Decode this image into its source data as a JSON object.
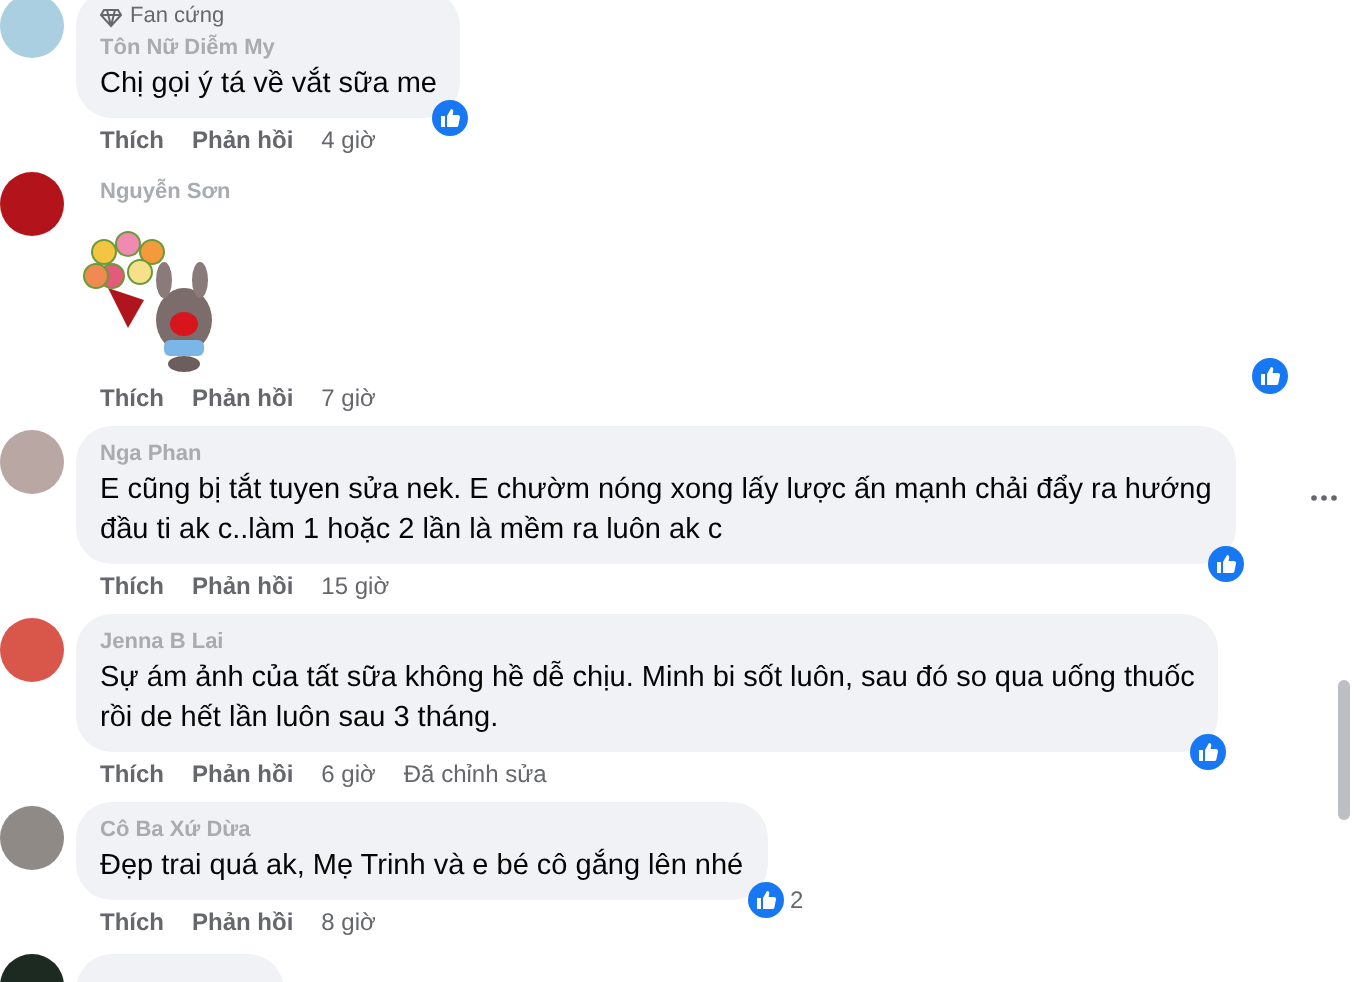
{
  "comments": [
    {
      "kind": "text",
      "badge": "Fan cứng",
      "name": "Tôn Nữ Diễm My",
      "text": "Chị gọi ý tá về vắt sữa me",
      "reacted": true,
      "actions": {
        "like": "Thích",
        "reply": "Phản hồi",
        "time": "4 giờ"
      },
      "more": false
    },
    {
      "kind": "sticker",
      "name": "Nguyễn Sơn",
      "reacted": true,
      "actions": {
        "like": "Thích",
        "reply": "Phản hồi",
        "time": "7 giờ"
      },
      "more": false
    },
    {
      "kind": "text",
      "name": "Nga Phan",
      "text": "E cũng bị tắt tuyen sửa nek. E chườm nóng xong lấy lược ấn mạnh chải đẩy ra hướng\nđầu ti ak c..làm 1 hoặc 2 lần là mềm ra luôn ak c",
      "reacted": true,
      "actions": {
        "like": "Thích",
        "reply": "Phản hồi",
        "time": "15 giờ"
      },
      "more": true
    },
    {
      "kind": "text",
      "name": "Jenna B Lai",
      "text": "Sự ám ảnh của tất sữa không hề dễ chịu. Minh bi sốt luôn, sau đó so qua uống thuốc\nrồi de hết lần luôn sau 3 tháng.",
      "reacted": true,
      "actions": {
        "like": "Thích",
        "reply": "Phản hồi",
        "time": "6 giờ",
        "edited": "Đã chỉnh sửa"
      },
      "more": false
    },
    {
      "kind": "text",
      "name": "Cô Ba Xứ Dừa",
      "text": "Đẹp trai quá ak, Mẹ Trinh và e bé cô gắng lên nhé",
      "reacted": true,
      "reaction_count": "2",
      "actions": {
        "like": "Thích",
        "reply": "Phản hồi",
        "time": "8 giờ"
      },
      "more": false
    },
    {
      "kind": "partial"
    }
  ]
}
